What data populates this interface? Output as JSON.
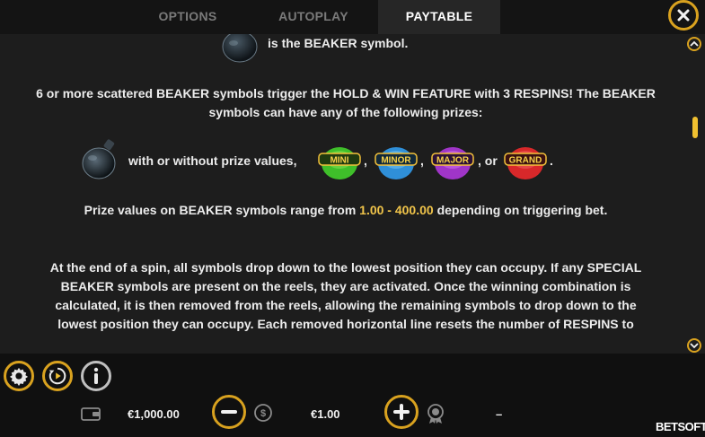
{
  "tabs": [
    {
      "label": "OPTIONS",
      "active": false
    },
    {
      "label": "AUTOPLAY",
      "active": false
    },
    {
      "label": "PAYTABLE",
      "active": true
    }
  ],
  "content": {
    "beaker_line": "is the BEAKER symbol.",
    "para1": "6 or more scattered BEAKER symbols trigger the HOLD & WIN FEATURE with 3 RESPINS! The BEAKER symbols can have any of the following prizes:",
    "prize_row": {
      "lead": "with or without prize values,",
      "sep1": ",",
      "sep2": ",",
      "sep3": ", or",
      "end": ".",
      "jackpots": [
        {
          "label": "MINI",
          "color": "#3fbf2a"
        },
        {
          "label": "MINOR",
          "color": "#2f8fd8"
        },
        {
          "label": "MAJOR",
          "color": "#a035c8"
        },
        {
          "label": "GRAND",
          "color": "#d8282a"
        }
      ]
    },
    "para2_a": "Prize values on BEAKER symbols range from",
    "para2_range": "1.00 - 400.00",
    "para2_b": "depending on triggering bet.",
    "para3": "At the end of a spin, all symbols drop down to the lowest position they can occupy. If any SPECIAL BEAKER symbols are present on the reels, they are activated. Once the winning combination is calculated, it is then removed from the reels, allowing the remaining symbols to drop down to the lowest position they can occupy. Each removed horizontal line resets the number of RESPINS to"
  },
  "bottom": {
    "balance": "€1,000.00",
    "bet": "€1.00",
    "win": "–",
    "logo": "BETSOFT"
  },
  "icons": {
    "close": "close-icon",
    "settings": "gear-icon",
    "autoplay": "autoplay-icon",
    "info": "info-icon",
    "wallet": "wallet-icon",
    "coins": "coins-icon",
    "award": "award-icon",
    "minus": "minus-icon",
    "plus": "plus-icon"
  },
  "colors": {
    "accent": "#d9a21f",
    "highlight": "#f0c44a",
    "background": "#1d1d1d"
  }
}
